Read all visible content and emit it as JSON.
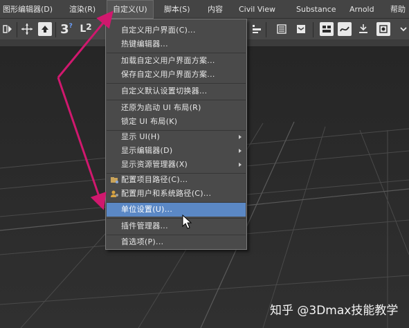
{
  "menubar": {
    "items": [
      "图形编辑器(D)",
      "渲染(R)",
      "自定义(U)",
      "脚本(S)",
      "内容",
      "Civil View",
      "Substance",
      "Arnold",
      "帮助"
    ],
    "active_index": 2
  },
  "toolbar": {
    "icons": [
      "mirror-icon",
      "move-icon",
      "select-object-icon",
      "snap-3-icon",
      "angle-snap-icon",
      "align-icon",
      "list-icon",
      "layer-icon",
      "graph-editor-icon",
      "curve-editor-icon",
      "schematic-icon",
      "material-editor-icon"
    ],
    "snap_label": "3",
    "angle_label": "2"
  },
  "customize_menu": {
    "items": [
      {
        "label": "自定义用户界面(C)..."
      },
      {
        "label": "热键编辑器..."
      },
      {
        "label": "加载自定义用户界面方案..."
      },
      {
        "label": "保存自定义用户界面方案..."
      },
      {
        "label": "自定义默认设置切换器..."
      },
      {
        "label": "还原为启动 UI 布局(R)"
      },
      {
        "label": "锁定 UI 布局(K)"
      },
      {
        "label": "显示 UI(H)"
      },
      {
        "label": "显示编辑器(D)"
      },
      {
        "label": "显示资源管理器(X)"
      },
      {
        "label": "配置项目路径(C)..."
      },
      {
        "label": "配置用户和系统路径(C)..."
      },
      {
        "label": "单位设置(U)..."
      },
      {
        "label": "插件管理器..."
      },
      {
        "label": "首选项(P)..."
      }
    ],
    "highlighted": "单位设置(U)..."
  },
  "watermark": "知乎 @3Dmax技能教学",
  "colors": {
    "highlight": "#5b88c5",
    "annotation_arrow": "#d0186e",
    "menu_bg": "#4a4a4a",
    "menubar_bg": "#444444",
    "viewport_bg": "#2b2b2b"
  }
}
